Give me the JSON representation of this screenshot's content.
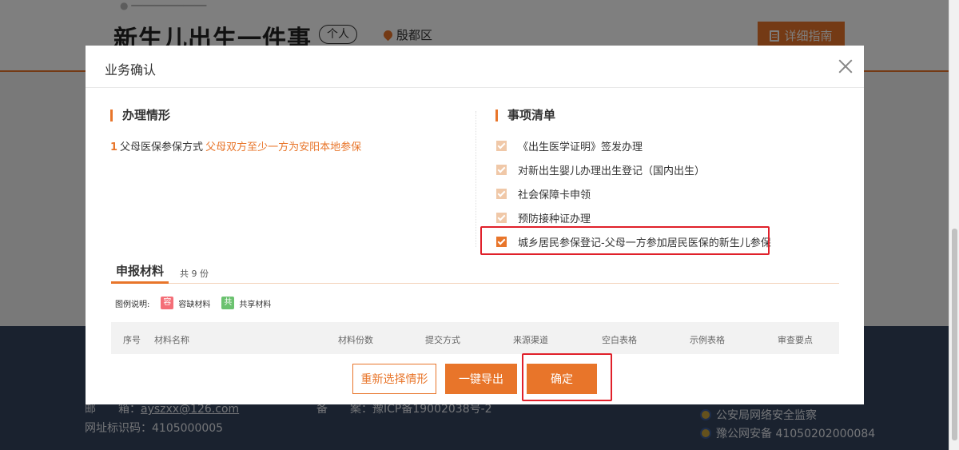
{
  "page": {
    "title": "新生儿出生一件事",
    "tag": "个人",
    "location": "殷都区",
    "guide_button": "详细指南"
  },
  "footer": {
    "email_label": "邮　　箱：",
    "email": "ayszxx@126.com",
    "record_label": "备　　案：",
    "record": "豫ICP备19002038号-2",
    "site_code": "网址标识码：4105000005",
    "police_supervision": "公安局网络安全监察",
    "police_record": "豫公网安备 41050202000084"
  },
  "modal": {
    "title": "业务确认",
    "situation": {
      "title": "办理情形",
      "index": "1",
      "question": "父母医保参保方式",
      "answer": "父母双方至少一方为安阳本地参保"
    },
    "items": {
      "title": "事项清单",
      "list": [
        {
          "label": "《出生医学证明》签发办理",
          "checked": true
        },
        {
          "label": "对新出生婴儿办理出生登记（国内出生）",
          "checked": true
        },
        {
          "label": "社会保障卡申领",
          "checked": true
        },
        {
          "label": "预防接种证办理",
          "checked": true
        },
        {
          "label": "城乡居民参保登记-父母一方参加居民医保的新生儿参保",
          "checked": true
        }
      ]
    },
    "materials": {
      "tab": "申报材料",
      "count": "共 9 份",
      "legend_label": "图例说明:",
      "legend_missing_badge": "容",
      "legend_missing": "容缺材料",
      "legend_shared_badge": "共",
      "legend_shared": "共享材料",
      "columns": [
        "序号",
        "材料名称",
        "材料份数",
        "提交方式",
        "来源渠道",
        "空白表格",
        "示例表格",
        "审查要点"
      ]
    },
    "buttons": {
      "reselect": "重新选择情形",
      "export": "一键导出",
      "confirm": "确定"
    }
  },
  "colors": {
    "accent": "#e8752a",
    "highlight": "#e0202a",
    "footer_bg": "#34455f"
  }
}
